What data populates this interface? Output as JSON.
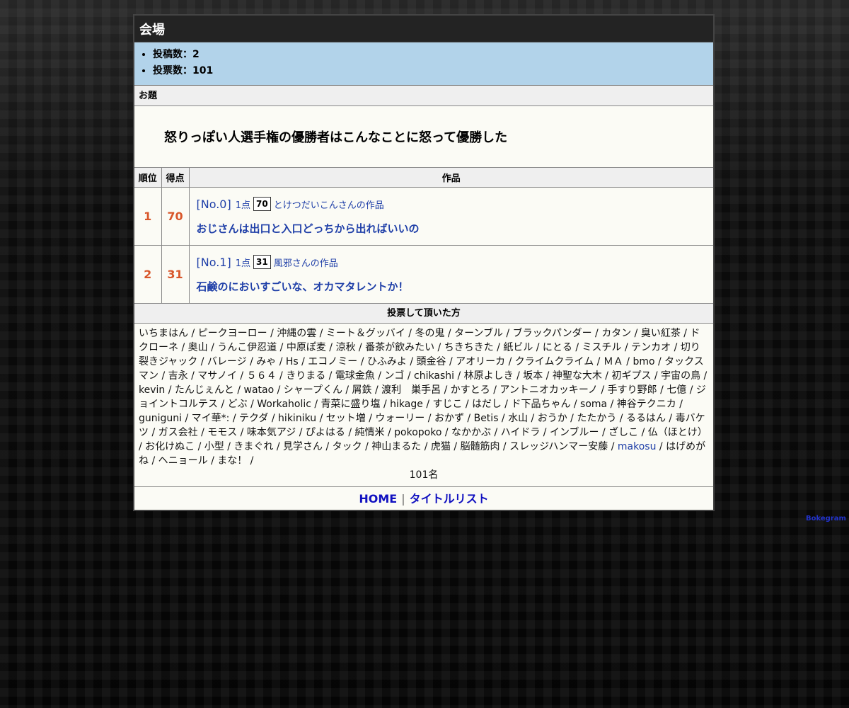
{
  "header": {
    "title": "会場"
  },
  "stats": [
    {
      "label": "投稿数：2"
    },
    {
      "label": "投票数：101"
    }
  ],
  "topic": {
    "label": "お題",
    "text": "怒りっぽい人選手権の優勝者はこんなことに怒って優勝した"
  },
  "results": {
    "columns": {
      "rank": "順位",
      "score": "得点",
      "work": "作品"
    },
    "rows": [
      {
        "rank": "1",
        "score": "70",
        "no": "[No.0]",
        "pts_label": "1点",
        "pts": "70",
        "author": "とけつだいこんさんの作品",
        "title": "おじさんは出口と入口どっちから出ればいいの"
      },
      {
        "rank": "2",
        "score": "31",
        "no": "[No.1]",
        "pts_label": "1点",
        "pts": "31",
        "author": "風邪さんの作品",
        "title": "石鹸のにおいすごいな、オカマタレントか！"
      }
    ]
  },
  "voters": {
    "label": "投票して頂いた方",
    "list_before": "いちまはん / ピークヨーロー / 沖縄の雲 / ミート＆グッバイ / 冬の鬼 / ターンブル / ブラックパンダー / カタン / 臭い紅茶 / ドクローネ / 奥山 / うんこ伊忍道 / 中原ぽ麦 / 涼秋 / 番茶が飲みたい / ちきちきた / 紙ビル / にとる / ミスチル / テンカオ / 切り裂きジャック / バレージ / みゃ / Hs / エコノミー / ひふみよ / 頭金谷 / アオリーカ / クライムクライム / ＭＡ / bmo / タックスマン / 吉永 / マサノイ / ５６４ / きりまる / 電球金魚 / ンゴ / chikashi / 林原よしき / 坂本 / 神聖な大木 / 初ギプス / 宇宙の鳥 / kevin / たんじぇんと / watao / シャープくん / 屑鉄 / 渡利　巣手呂 / かすとろ / アントニオカッキーノ / 手すり野郎 / 七億 / ジョイントコルテス / どぶ / Workaholic / 青菜に盛り塩 / hikage / すじこ / はだし / ド下品ちゃん / soma / 神谷テクニカ / guniguni / マイ華*: / テクダ / hikiniku / セット増 / ウォーリー / おかず / Betis / 水山 / おうか / たたかう / るるはん / 毒バケツ / ガス会社 / モモス / 味本気アジ / ぴよはる / 純情米 / pokopoko / なかかぶ / ハイドラ / インブルー / ざしこ / 仏（ほとけ） / お化けぬこ / 小型 / きまぐれ / 見学さん / タック / 神山まるた / 虎猫 / 脳髄筋肉 / スレッジハンマー安藤 / ",
    "link": "makosu",
    "list_after": " / はげめがね / ヘニョール / まな！ /",
    "count": "101名"
  },
  "footer": {
    "home": "HOME",
    "sep": "|",
    "titles": "タイトルリスト"
  },
  "credit": "Bokegram"
}
